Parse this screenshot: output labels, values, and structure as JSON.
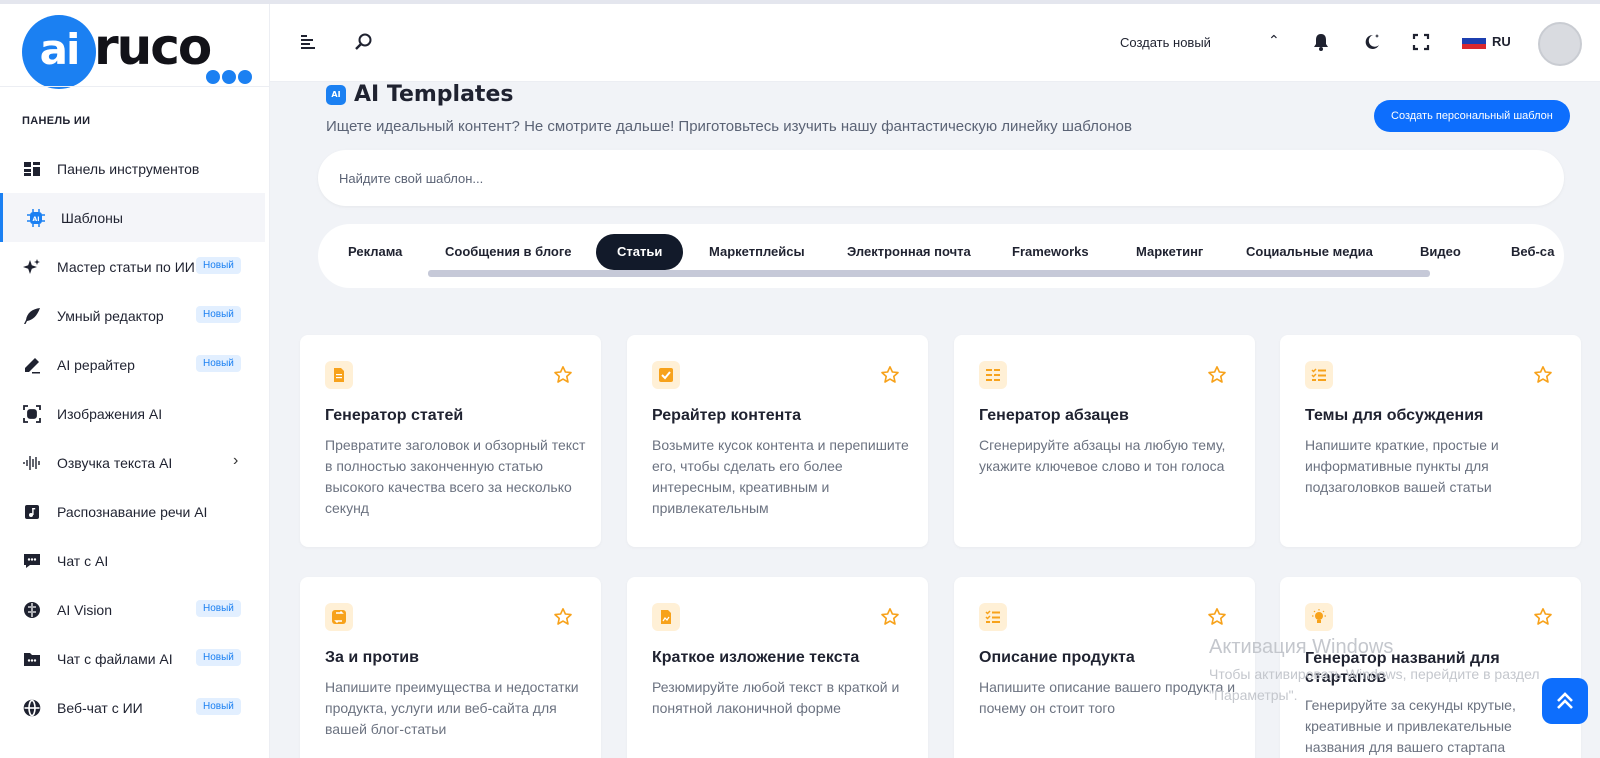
{
  "brand": {
    "logo_ai": "ai",
    "logo_text": "ruco"
  },
  "sidebar": {
    "section_title": "ПАНЕЛЬ ИИ",
    "items": [
      {
        "label": "Панель инструментов",
        "icon": "dashboard-icon"
      },
      {
        "label": "Шаблоны",
        "icon": "ai-chip-icon",
        "active": true
      },
      {
        "label": "Мастер статьи по ИИ",
        "icon": "sparkles-icon",
        "badge": "Новый"
      },
      {
        "label": "Умный редактор",
        "icon": "feather-icon",
        "badge": "Новый"
      },
      {
        "label": "AI рерайтер",
        "icon": "pen-icon",
        "badge": "Новый"
      },
      {
        "label": "Изображения AI",
        "icon": "image-scan-icon"
      },
      {
        "label": "Озвучка текста AI",
        "icon": "soundwave-icon",
        "has_submenu": true
      },
      {
        "label": "Распознавание речи AI",
        "icon": "music-file-icon"
      },
      {
        "label": "Чат с AI",
        "icon": "chat-icon"
      },
      {
        "label": "AI Vision",
        "icon": "brain-icon",
        "badge": "Новый"
      },
      {
        "label": "Чат с файлами AI",
        "icon": "folder-icon",
        "badge": "Новый"
      },
      {
        "label": "Веб-чат с ИИ",
        "icon": "globe-icon",
        "badge": "Новый"
      }
    ]
  },
  "header": {
    "create_new": "Создать новый",
    "lang": "RU"
  },
  "main": {
    "title": "AI Templates",
    "title_chip": "AI",
    "subtitle": "Ищете идеальный контент? Не смотрите дальше! Приготовьтесь изучить нашу фантастическую линейку шаблонов",
    "create_button": "Создать персональный шаблон",
    "search_placeholder": "Найдите свой шаблон...",
    "tabs": [
      "Реклама",
      "Сообщения в блоге",
      "Статьи",
      "Маркетплейсы",
      "Электронная почта",
      "Frameworks",
      "Маркетинг",
      "Социальные медиа",
      "Видео",
      "Веб-са"
    ],
    "active_tab": "Статьи"
  },
  "cards": [
    {
      "title": "Генератор статей",
      "desc": "Превратите заголовок и обзорный текст в полностью законченную статью высокого качества всего за несколько секунд",
      "icon": "document-icon"
    },
    {
      "title": "Рерайтер контента",
      "desc": "Возьмите кусок контента и перепишите его, чтобы сделать его более интересным, креативным и привлекательным",
      "icon": "check-square-icon"
    },
    {
      "title": "Генератор абзацев",
      "desc": "Сгенерируйте абзацы на любую тему, укажите ключевое слово и тон голоса",
      "icon": "paragraph-icon"
    },
    {
      "title": "Темы для обсуждения",
      "desc": "Напишите краткие, простые и информативные пункты для подзаголовков вашей статьи",
      "icon": "checklist-icon"
    },
    {
      "title": "За и против",
      "desc": "Напишите преимущества и недостатки продукта, услуги или веб-сайта для вашей блог-статьи",
      "icon": "swap-icon"
    },
    {
      "title": "Краткое изложение текста",
      "desc": "Резюмируйте любой текст в краткой и понятной лаконичной форме",
      "icon": "file-text-icon"
    },
    {
      "title": "Описание продукта",
      "desc": "Напишите описание вашего продукта и почему он стоит того",
      "icon": "checklist-icon"
    },
    {
      "title": "Генератор названий для стартапов",
      "desc": "Генерируйте за секунды крутые, креативные и привлекательные названия для вашего стартапа",
      "icon": "lightbulb-icon"
    }
  ],
  "watermark": {
    "line1": "Активация Windows",
    "line2": "Чтобы активировать Windows, перейдите в раздел \"Параметры\"."
  },
  "colors": {
    "accent": "#1b80f2",
    "button": "#0d6efd",
    "card_icon_bg": "#fff0d6",
    "card_icon": "#f7a21b",
    "active_tab": "#121a2a"
  }
}
